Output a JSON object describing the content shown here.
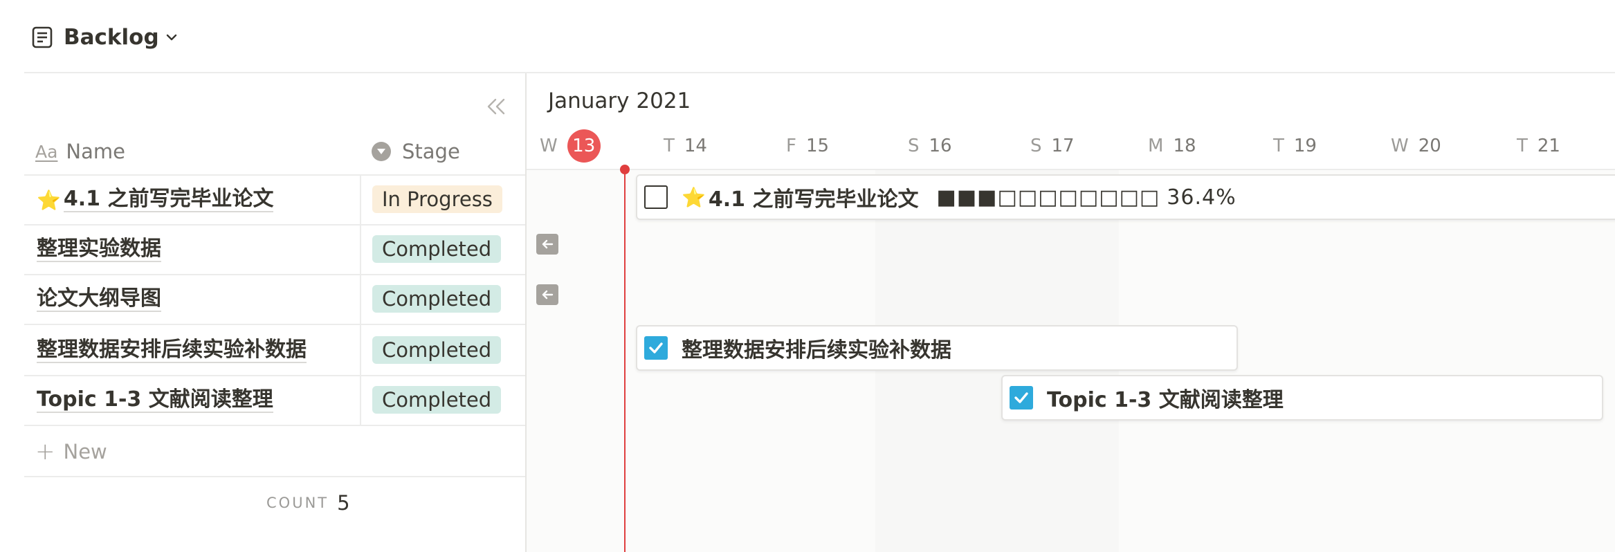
{
  "header": {
    "title": "Backlog"
  },
  "table": {
    "columns": {
      "name": "Name",
      "name_icon": "Aa",
      "stage": "Stage"
    },
    "rows": [
      {
        "star": "⭐",
        "name": "4.1 之前写完毕业论文",
        "stage": "In Progress"
      },
      {
        "name": "整理实验数据",
        "stage": "Completed"
      },
      {
        "name": "论文大纲导图",
        "stage": "Completed"
      },
      {
        "name": "整理数据安排后续实验补数据",
        "stage": "Completed"
      },
      {
        "name": "Topic 1-3 文献阅读整理",
        "stage": "Completed"
      }
    ],
    "new_label": "New",
    "count_label": "COUNT",
    "count_value": "5"
  },
  "timeline": {
    "month": "January 2021",
    "days": [
      {
        "dow": "W",
        "num": "13",
        "today": true
      },
      {
        "dow": "T",
        "num": "14"
      },
      {
        "dow": "F",
        "num": "15"
      },
      {
        "dow": "S",
        "num": "16"
      },
      {
        "dow": "S",
        "num": "17"
      },
      {
        "dow": "M",
        "num": "18"
      },
      {
        "dow": "T",
        "num": "19"
      },
      {
        "dow": "W",
        "num": "20"
      },
      {
        "dow": "T",
        "num": "21"
      }
    ],
    "bars": [
      {
        "star": "⭐",
        "title": "4.1 之前写完毕业论文",
        "checked": false,
        "progress_blocks": "■■■□□□□□□□□",
        "progress_text": "36.4%"
      },
      {
        "title": "整理数据安排后续实验补数据",
        "checked": true
      },
      {
        "title": "Topic 1-3 文献阅读整理",
        "checked": true
      }
    ]
  },
  "colors": {
    "accent": "#2eaadc",
    "today": "#eb5757",
    "in_progress_bg": "#fbeeda",
    "completed_bg": "#d3ebe5"
  },
  "icons": [
    "doc-icon",
    "chevron-down-icon",
    "collapse-left-icon",
    "stage-select-icon",
    "plus-icon",
    "arrow-left-icon",
    "checkbox-icon",
    "star-icon"
  ]
}
